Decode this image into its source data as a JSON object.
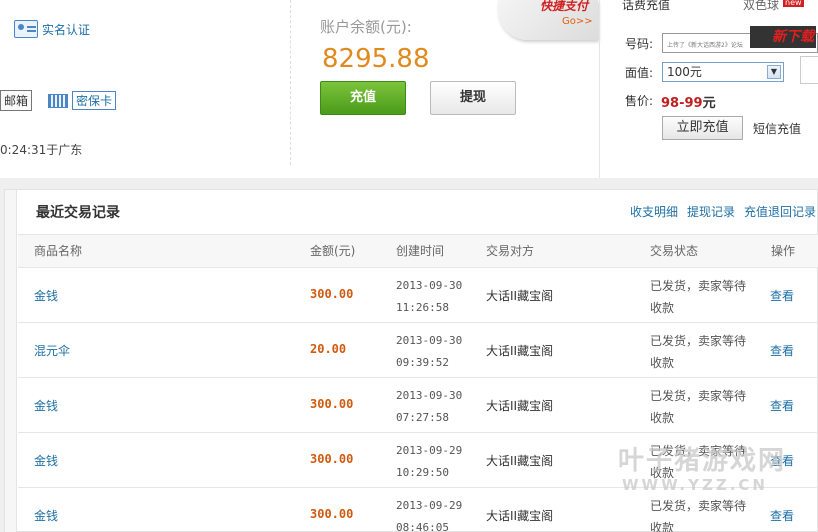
{
  "account": {
    "realname_label": "实名认证",
    "email_label": "邮箱",
    "mibao_label": "密保卡",
    "login_info": "0:24:31于广东"
  },
  "balance": {
    "label": "账户余额(元):",
    "value": "8295.88",
    "charge_button": "充值",
    "withdraw_button": "提现"
  },
  "quickpay": {
    "title": "快捷支付",
    "go": "Go>>"
  },
  "phone_recharge": {
    "title": "话费充值",
    "tab2": "双色球",
    "new_badge": "new",
    "number_label": "号码:",
    "number_placeholder": "上传了《新大话西游2》论坛",
    "ad_text": "新下载",
    "face_label": "面值:",
    "face_value": "100元",
    "price_label": "售价:",
    "price_value": "98-99",
    "price_unit": "元",
    "instant_button": "立即充值",
    "sms_link": "短信充值"
  },
  "transactions": {
    "title": "最近交易记录",
    "links": [
      "收支明细",
      "提现记录",
      "充值退回记录"
    ],
    "headers": {
      "name": "商品名称",
      "amount": "金额(元)",
      "created": "创建时间",
      "party": "交易对方",
      "status": "交易状态",
      "op": "操作"
    },
    "rows": [
      {
        "name": "金钱",
        "amount": "300.00",
        "date": "2013-09-30",
        "time": "11:26:58",
        "party": "大话II藏宝阁",
        "status1": "已发货，卖家等待",
        "status2": "收款",
        "op": "查看"
      },
      {
        "name": "混元伞",
        "amount": "20.00",
        "date": "2013-09-30",
        "time": "09:39:52",
        "party": "大话II藏宝阁",
        "status1": "已发货，卖家等待",
        "status2": "收款",
        "op": "查看"
      },
      {
        "name": "金钱",
        "amount": "300.00",
        "date": "2013-09-30",
        "time": "07:27:58",
        "party": "大话II藏宝阁",
        "status1": "已发货，卖家等待",
        "status2": "收款",
        "op": "查看"
      },
      {
        "name": "金钱",
        "amount": "300.00",
        "date": "2013-09-29",
        "time": "10:29:50",
        "party": "大话II藏宝阁",
        "status1": "已发货，卖家等待",
        "status2": "收款",
        "op": "查看"
      },
      {
        "name": "金钱",
        "amount": "300.00",
        "date": "2013-09-29",
        "time": "08:46:05",
        "party": "大话II藏宝阁",
        "status1": "已发货，卖家等待",
        "status2": "收款",
        "op": "查看"
      }
    ]
  },
  "watermark": {
    "cn": "叶子猪游戏网",
    "url": "WWW.YZZ.CN"
  },
  "colors": {
    "link": "#1d6fa5",
    "amount": "#d05a10",
    "balance": "#e08a1e",
    "charge_green": "#4a9b1a",
    "price_red": "#c02020"
  }
}
